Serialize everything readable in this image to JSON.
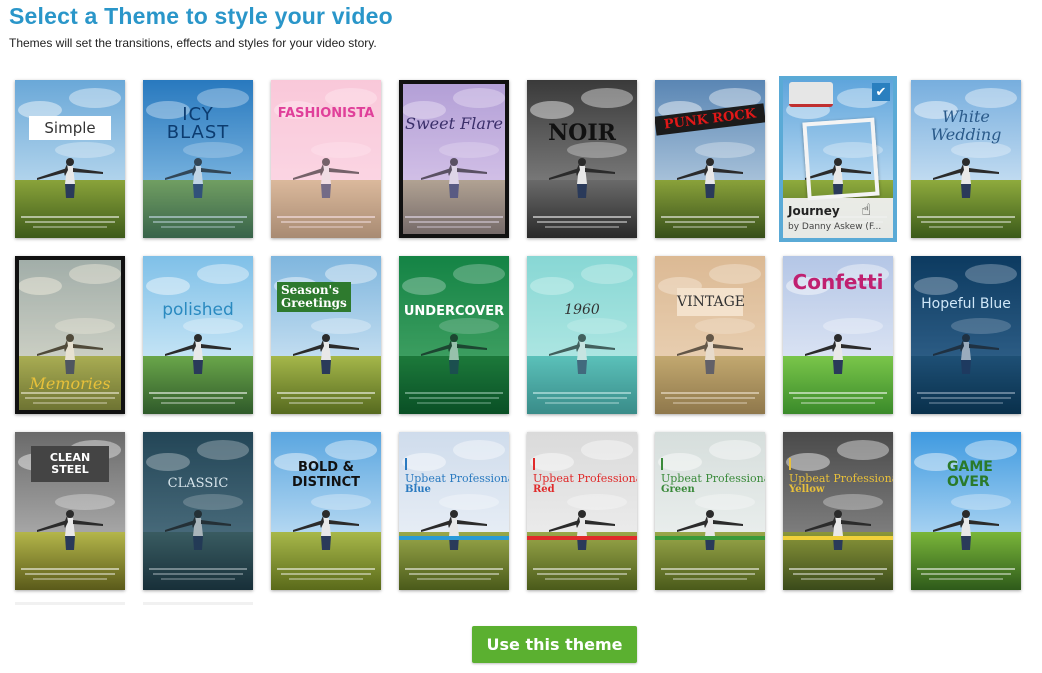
{
  "header": {
    "title": "Select a Theme to style your video",
    "subtitle": "Themes will set the transitions, effects and styles for your video story."
  },
  "themes": [
    {
      "name": "Simple"
    },
    {
      "name": "ICY BLAST"
    },
    {
      "name": "FASHIONISTA"
    },
    {
      "name": "Sweet Flare"
    },
    {
      "name": "NOIR"
    },
    {
      "name": "PUNK ROCK"
    },
    {
      "name": "Journey",
      "author": "by Danny Askew (F...",
      "selected": true
    },
    {
      "name": "White Wedding"
    },
    {
      "name": "Memories"
    },
    {
      "name": "polished"
    },
    {
      "name": "Season's Greetings"
    },
    {
      "name": "UNDERCOVER"
    },
    {
      "name": "1960"
    },
    {
      "name": "VINTAGE"
    },
    {
      "name": "Confetti"
    },
    {
      "name": "Hopeful Blue"
    },
    {
      "name": "CLEAN STEEL"
    },
    {
      "name": "CLASSIC"
    },
    {
      "name": "BOLD & DISTINCT"
    },
    {
      "name": "Upbeat Professional Blue",
      "line1": "Upbeat Professional",
      "line2": "Blue"
    },
    {
      "name": "Upbeat Professional Red",
      "line1": "Upbeat Professional",
      "line2": "Red"
    },
    {
      "name": "Upbeat Professional Green",
      "line1": "Upbeat Professional",
      "line2": "Green"
    },
    {
      "name": "Upbeat Professional Yellow",
      "line1": "Upbeat Professional",
      "line2": "Yellow"
    },
    {
      "name": "GAME OVER"
    }
  ],
  "selected_check": "✔",
  "cursor_icon": "☝",
  "actions": {
    "use_theme_label": "Use this theme"
  },
  "colors": {
    "title": "#2a96c9",
    "button": "#5bb030",
    "selected_border": "#5aaad6"
  }
}
